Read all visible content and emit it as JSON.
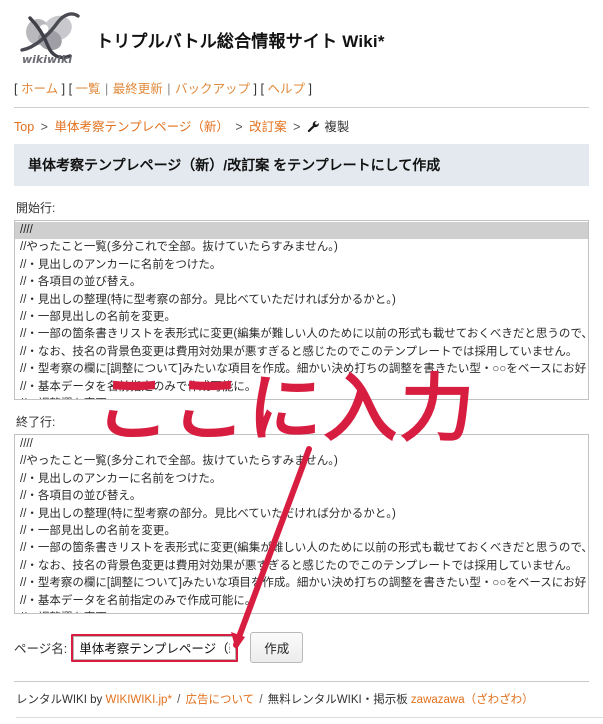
{
  "header": {
    "logo_alt": "wikiwiki-logo",
    "logo_wordmark": "wikiwiki",
    "title": "トリプルバトル総合情報サイト Wiki*"
  },
  "nav": {
    "groups": [
      {
        "open": "[",
        "items": [
          {
            "label": "ホーム"
          }
        ],
        "close": "]"
      },
      {
        "open": "[",
        "items": [
          {
            "label": "一覧"
          },
          {
            "label": "最終更新"
          },
          {
            "label": "バックアップ"
          }
        ],
        "close": "]"
      },
      {
        "open": "[",
        "items": [
          {
            "label": "ヘルプ"
          }
        ],
        "close": "]"
      }
    ],
    "separator": "|"
  },
  "breadcrumb": {
    "separator": ">",
    "items": [
      {
        "label": "Top",
        "link": true
      },
      {
        "label": "単体考察テンプレページ（新）",
        "link": true
      },
      {
        "label": "改訂案",
        "link": true
      },
      {
        "label": "複製",
        "link": false,
        "icon": "wrench-icon"
      }
    ]
  },
  "page_heading": "単体考察テンプレページ（新）/改訂案 をテンプレートにして作成",
  "form": {
    "start_line": {
      "label": "開始行:",
      "options": [
        {
          "text": "////",
          "selected": true
        },
        {
          "text": "//やったこと一覧(多分これで全部。抜けていたらすみません。)",
          "selected": false
        },
        {
          "text": "//・見出しのアンカーに名前をつけた。",
          "selected": false
        },
        {
          "text": "//・各項目の並び替え。",
          "selected": false
        },
        {
          "text": "//・見出しの整理(特に型考察の部分。見比べていただければ分かるかと。)",
          "selected": false
        },
        {
          "text": "//・一部見出しの名前を変更。",
          "selected": false
        },
        {
          "text": "//・一部の箇条書きリストを表形式に変更(編集が難しい人のために以前の形式も載せておくべきだと思うので、",
          "selected": false
        },
        {
          "text": "//・なお、技名の背景色変更は費用対効果が悪すぎると感じたのでこのテンプレートでは採用していません。",
          "selected": false
        },
        {
          "text": "//・型考察の欄に[調整について]みたいな項目を作成。細かい決め打ちの調整を書きたい型・○○をベースにお好",
          "selected": false
        },
        {
          "text": "//・基本データを名前指定のみで作成可能に。",
          "selected": false
        },
        {
          "text": "//・調整欄を変更",
          "selected": false
        }
      ]
    },
    "end_line": {
      "label": "終了行:",
      "options": [
        {
          "text": "////",
          "selected": false
        },
        {
          "text": "//やったこと一覧(多分これで全部。抜けていたらすみません。)",
          "selected": false
        },
        {
          "text": "//・見出しのアンカーに名前をつけた。",
          "selected": false
        },
        {
          "text": "//・各項目の並び替え。",
          "selected": false
        },
        {
          "text": "//・見出しの整理(特に型考察の部分。見比べていただければ分かるかと。)",
          "selected": false
        },
        {
          "text": "//・一部見出しの名前を変更。",
          "selected": false
        },
        {
          "text": "//・一部の箇条書きリストを表形式に変更(編集が難しい人のために以前の形式も載せておくべきだと思うので、",
          "selected": false
        },
        {
          "text": "//・なお、技名の背景色変更は費用対効果が悪すぎると感じたのでこのテンプレートでは採用していません。",
          "selected": false
        },
        {
          "text": "//・型考察の欄に[調整について]みたいな項目を作成。細かい決め打ちの調整を書きたい型・○○をベースにお好",
          "selected": false
        },
        {
          "text": "//・基本データを名前指定のみで作成可能に。",
          "selected": false
        },
        {
          "text": "//・調整欄を変更",
          "selected": false
        }
      ]
    },
    "pagename": {
      "label": "ページ名:",
      "value": "単体考察テンプレページ（新）",
      "placeholder": ""
    },
    "create_button": "作成"
  },
  "annotation": {
    "text": "ここに入力",
    "color": "#d81e40",
    "arrow": "points from annotation text down-left to the page name input"
  },
  "footer": {
    "prefix": "レンタルWIKI by",
    "brand": "WIKIWIKI.jp*",
    "sep1": "/",
    "ads_link": "広告について",
    "sep2": "/",
    "middle": "無料レンタルWIKI・掲示板",
    "board_link": "zawazawa（ざわざわ）"
  },
  "colors": {
    "accent_link": "#E2711D",
    "nav_link": "#E08A3C",
    "heading_bg": "#e3e9ee",
    "annotation_red": "#d81e40",
    "selected_option_bg": "#cfcfcf"
  }
}
